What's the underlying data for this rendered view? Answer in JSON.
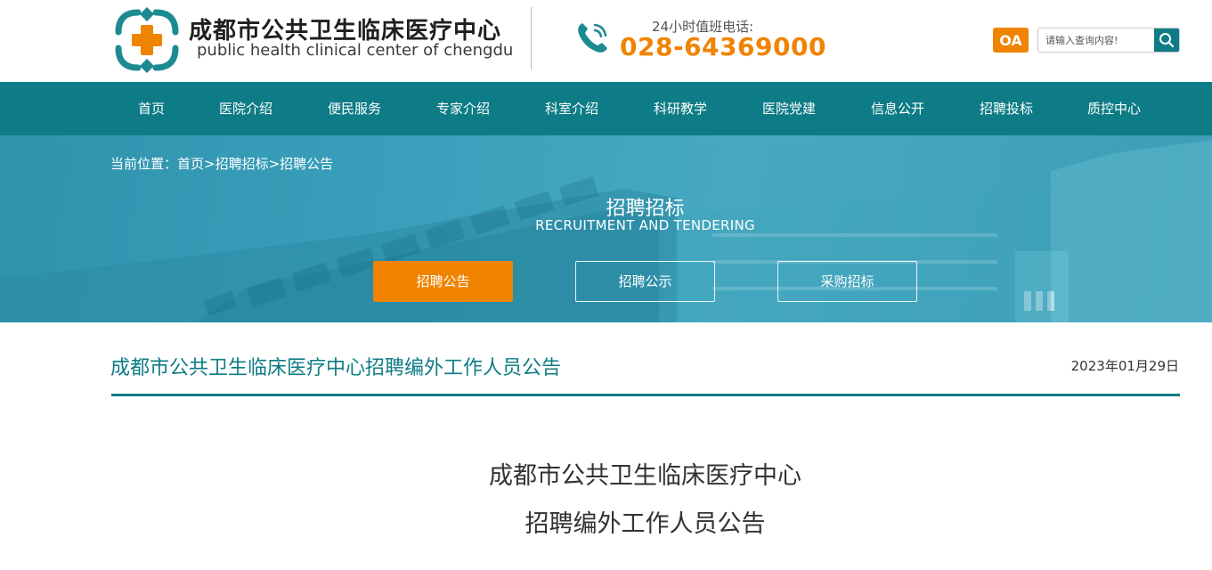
{
  "header": {
    "brand_cn": "成都市公共卫生临床医疗中心",
    "brand_en": "public health clinical center of chengdu",
    "hotline_label": "24小时值班电话:",
    "hotline_number": "028-64369000",
    "oa_label": "OA",
    "search_placeholder": "请输入查询内容!"
  },
  "nav": {
    "items": [
      "首页",
      "医院介绍",
      "便民服务",
      "专家介绍",
      "科室介绍",
      "科研教学",
      "医院党建",
      "信息公开",
      "招聘投标",
      "质控中心"
    ]
  },
  "banner": {
    "breadcrumb": "当前位置：首页>招聘招标>招聘公告",
    "title": "招聘招标",
    "subtitle": "RECRUITMENT AND TENDERING",
    "tabs": [
      "招聘公告",
      "招聘公示",
      "采购招标"
    ],
    "active_tab": 0
  },
  "article": {
    "title": "成都市公共卫生临床医疗中心招聘编外工作人员公告",
    "date": "2023年01月29日",
    "heading_line1": "成都市公共卫生临床医疗中心",
    "heading_line2": "招聘编外工作人员公告"
  },
  "colors": {
    "primary": "#0e7c86",
    "accent": "#f08300"
  }
}
